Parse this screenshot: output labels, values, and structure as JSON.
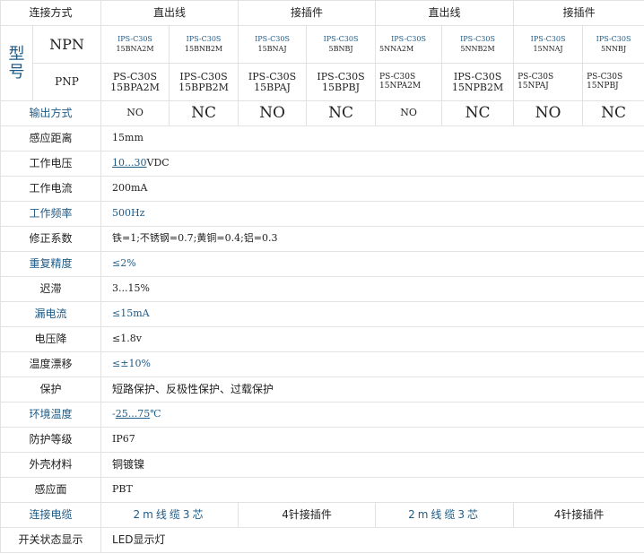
{
  "header": {
    "connection_label": "连接方式",
    "groups": [
      "直出线",
      "接插件",
      "直出线",
      "接插件"
    ]
  },
  "model_label": "型号",
  "npn": {
    "label": "NPN",
    "models": [
      {
        "l1": "IPS-C30S",
        "l2": "15BNA2M"
      },
      {
        "l1": "IPS-C30S",
        "l2": "15BNB2M"
      },
      {
        "l1": "IPS-C30S",
        "l2": "15BNAJ"
      },
      {
        "l1": "IPS-C30S",
        "l2": "5BNBJ"
      },
      {
        "l1": "IPS-C30S",
        "l2": "5NNA2M"
      },
      {
        "l1": "IPS-C30S",
        "l2": "5NNB2M"
      },
      {
        "l1": "IPS-C30S",
        "l2": "15NNAJ"
      },
      {
        "l1": "IPS-C30S",
        "l2": "5NNBJ"
      }
    ]
  },
  "pnp": {
    "label": "PNP",
    "models": [
      {
        "l1": "PS-C30S",
        "l2": "15BPA2M"
      },
      {
        "l1": "IPS-C30S",
        "l2": "15BPB2M"
      },
      {
        "l1": "IPS-C30S",
        "l2": "15BPAJ"
      },
      {
        "l1": "IPS-C30S",
        "l2": "15BPBJ"
      },
      {
        "l1": "PS-C30S",
        "l2": "15NPA2M"
      },
      {
        "l1": "IPS-C30S",
        "l2": "15NPB2M"
      },
      {
        "l1": "PS-C30S",
        "l2": "15NPAJ"
      },
      {
        "l1": "PS-C30S",
        "l2": "15NPBJ"
      }
    ]
  },
  "output": {
    "label": "输出方式",
    "values": [
      "NO",
      "NC",
      "NO",
      "NC",
      "NO",
      "NC",
      "NO",
      "NC"
    ]
  },
  "specs": {
    "distance": {
      "label": "感应距离",
      "value": "15mm"
    },
    "voltage": {
      "label": "工作电压",
      "link": "10...30",
      "unit": "VDC"
    },
    "current": {
      "label": "工作电流",
      "value": "200mA"
    },
    "frequency": {
      "label": "工作频率",
      "value": "500Hz"
    },
    "correction": {
      "label": "修正系数",
      "value": "铁=1;不锈钢=0.7;黄铜=0.4;铝=0.3"
    },
    "repeat": {
      "label": "重复精度",
      "value": "≤2%"
    },
    "hysteresis": {
      "label": "迟滞",
      "value": "3...15%"
    },
    "leakage": {
      "label": "漏电流",
      "value": "≤15mA"
    },
    "vdrop": {
      "label": "电压降",
      "value": "≤1.8v"
    },
    "drift": {
      "label": "温度漂移",
      "value": "≤±10%"
    },
    "protection": {
      "label": "保护",
      "value": "短路保护、反极性保护、过载保护"
    },
    "ambient": {
      "label": "环境温度",
      "prefix": "-",
      "link": "25...75",
      "unit": "℃"
    },
    "ip": {
      "label": "防护等级",
      "value": "IP67"
    },
    "housing": {
      "label": "外壳材料",
      "value": "铜镀镍"
    },
    "face": {
      "label": "感应面",
      "value": "PBT"
    }
  },
  "cable": {
    "label": "连接电缆",
    "values": [
      "2m线缆3芯",
      "4针接插件",
      "2m线缆3芯",
      "4针接插件"
    ]
  },
  "switch_indicator": {
    "label": "开关状态显示",
    "value": "LED显示灯"
  }
}
